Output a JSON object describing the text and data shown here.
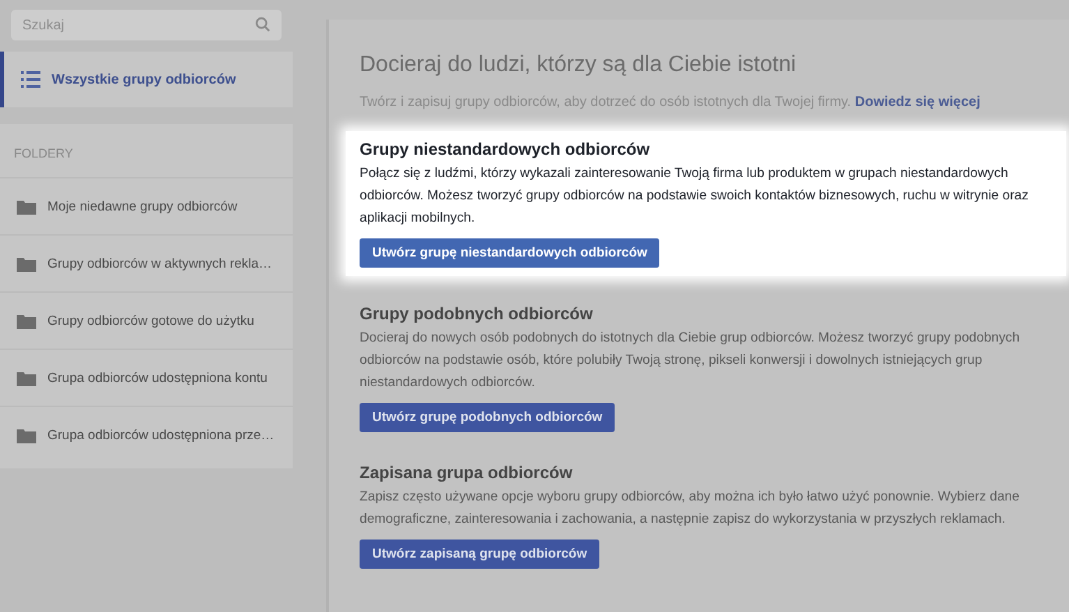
{
  "sidebar": {
    "search": {
      "placeholder": "Szukaj"
    },
    "nav_items": [
      {
        "label": "Wszystkie grupy odbiorców",
        "selected": true
      }
    ],
    "folders_heading": "FOLDERY",
    "folders": [
      {
        "label": "Moje niedawne grupy odbiorców"
      },
      {
        "label": "Grupy odbiorców w aktywnych rekla…"
      },
      {
        "label": "Grupy odbiorców gotowe do użytku"
      },
      {
        "label": "Grupa odbiorców udostępniona kontu"
      },
      {
        "label": "Grupa odbiorców udostępniona prze…"
      }
    ]
  },
  "main": {
    "title": "Docieraj do ludzi, którzy są dla Ciebie istotni",
    "intro": "Twórz i zapisuj grupy odbiorców, aby dotrzeć do osób istotnych dla Twojej firmy.",
    "intro_link": "Dowiedz się więcej",
    "sections": [
      {
        "title": "Grupy niestandardowych odbiorców",
        "highlighted": true,
        "text": "Połącz się z ludźmi, którzy wykazali zainteresowanie Twoją firma lub produktem w grupach niestandardowych odbiorców. Możesz tworzyć grupy odbiorców na podstawie swoich kontaktów biznesowych, ruchu w witrynie oraz aplikacji mobilnych.",
        "button": "Utwórz grupę niestandardowych odbiorców"
      },
      {
        "title": "Grupy podobnych odbiorców",
        "highlighted": false,
        "text": "Docieraj do nowych osób podobnych do istotnych dla Ciebie grup odbiorców. Możesz tworzyć grupy podobnych odbiorców na podstawie osób, które polubiły Twoją stronę, pikseli konwersji i dowolnych istniejących grup niestandardowych odbiorców.",
        "button": "Utwórz grupę podobnych odbiorców"
      },
      {
        "title": "Zapisana grupa odbiorców",
        "highlighted": false,
        "text": "Zapisz często używane opcje wyboru grupy odbiorców, aby można ich było łatwo użyć ponownie. Wybierz dane demograficzne, zainteresowania i zachowania, a następnie zapisz do wykorzystania w przyszłych reklamach.",
        "button": "Utwórz zapisaną grupę odbiorców"
      }
    ]
  }
}
